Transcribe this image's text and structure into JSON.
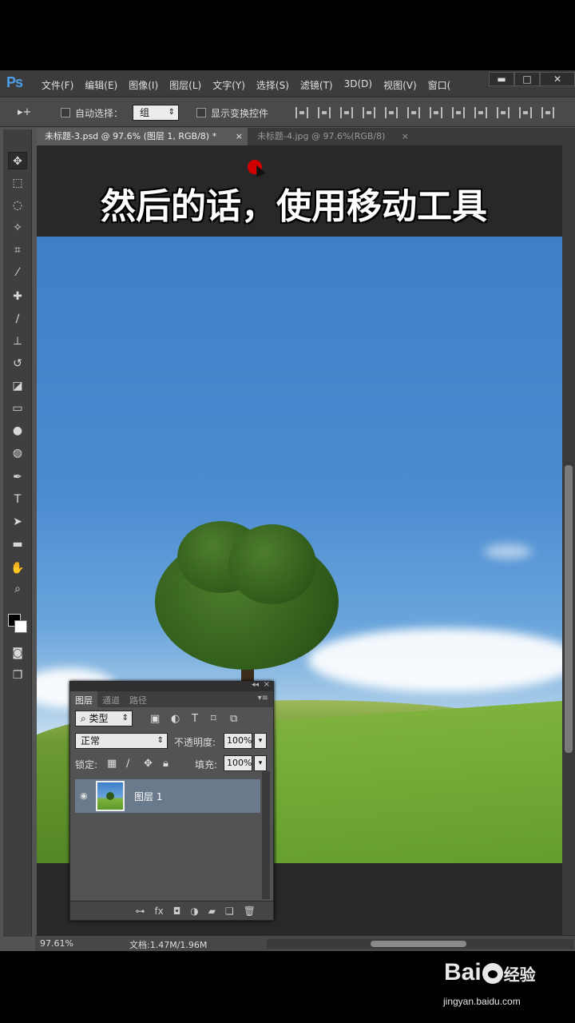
{
  "app": {
    "logo": "Ps"
  },
  "menu": [
    "文件(F)",
    "编辑(E)",
    "图像(I)",
    "图层(L)",
    "文字(Y)",
    "选择(S)",
    "滤镜(T)",
    "3D(D)",
    "视图(V)",
    "窗口("
  ],
  "window_controls": {
    "minimize": "▬",
    "maximize": "□",
    "close": "✕"
  },
  "options": {
    "tool_icon": "▸+",
    "auto_select_label": "自动选择：",
    "auto_select_value": "组",
    "show_transform_label": "显示变换控件"
  },
  "tabs": [
    {
      "label": "未标题-3.psd @ 97.6% (图层 1, RGB/8) *",
      "close": "×"
    },
    {
      "label": "未标题-4.jpg @ 97.6%(RGB/8)",
      "close": "×"
    }
  ],
  "caption": "然后的话，使用移动工具",
  "layers_panel": {
    "tabs": [
      "图层",
      "通道",
      "路径"
    ],
    "filter_value": "类型",
    "blend_mode": "正常",
    "opacity_label": "不透明度:",
    "opacity_value": "100%",
    "lock_label": "锁定:",
    "fill_label": "填充:",
    "fill_value": "100%",
    "layer_name": "图层 1",
    "collapse": "◂◂",
    "close": "×",
    "menu": "▾≡"
  },
  "status": {
    "zoom": "97.61%",
    "doc_info": "文档:1.47M/1.96M"
  },
  "watermark": {
    "brand_a": "Bai",
    "brand_b": "经验",
    "url": "jingyan.baidu.com"
  }
}
